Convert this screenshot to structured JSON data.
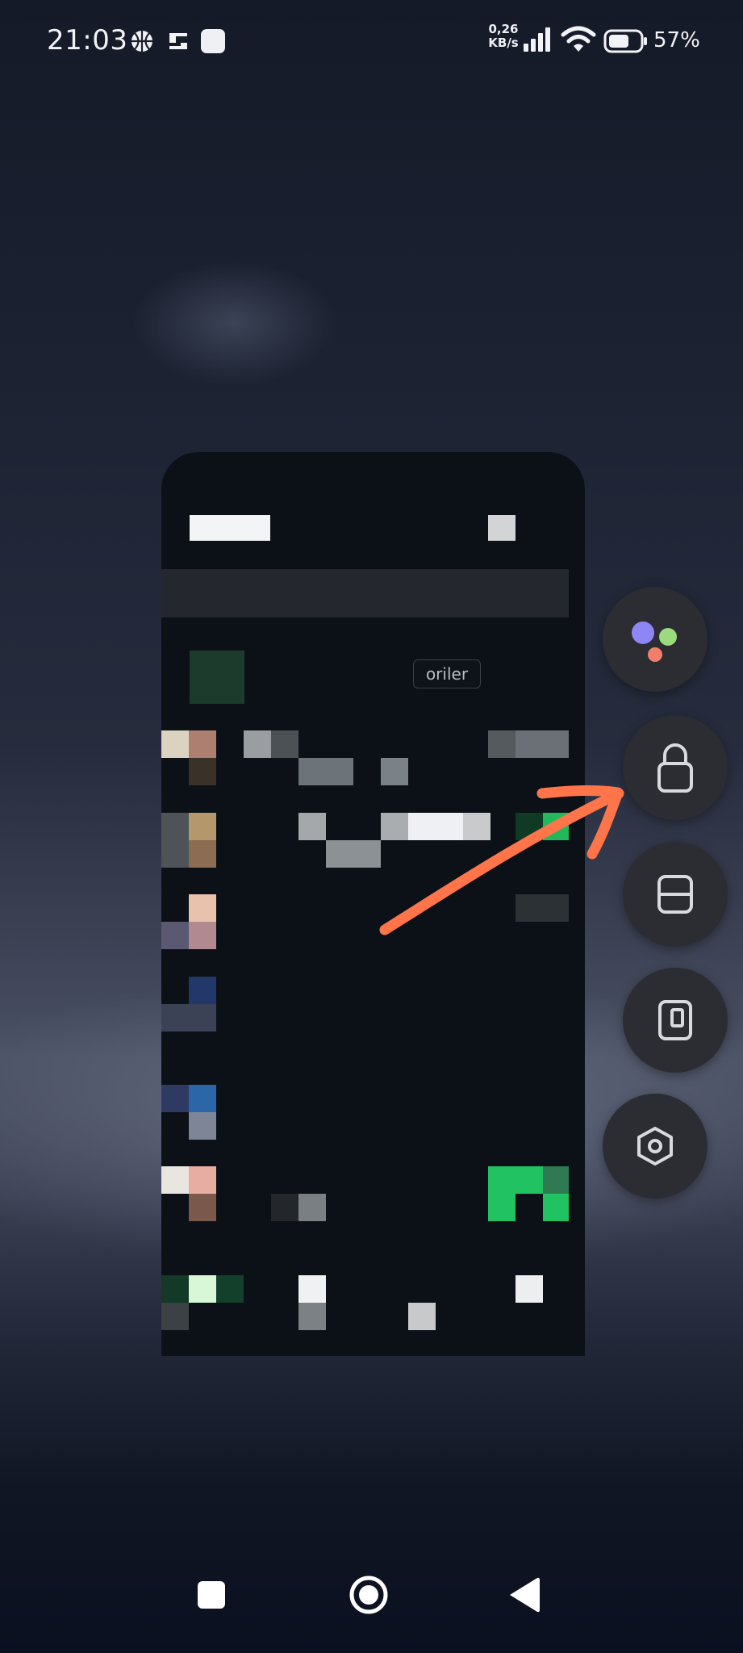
{
  "status_bar": {
    "time": "21:03",
    "notification_icons": [
      "basketball-icon",
      "app-notification-icon",
      "app-square-icon"
    ],
    "network_speed_value": "0,26",
    "network_speed_unit": "KB/s",
    "signal_icon": "cellular-signal-icon",
    "wifi_icon": "wifi-icon",
    "battery_icon": "battery-icon",
    "battery_percent": "57%"
  },
  "recent_app_card": {
    "visible_text": "oriler",
    "content_state": "pixelated"
  },
  "side_actions": [
    {
      "name": "assistant-button",
      "icon": "assistant-dots-icon"
    },
    {
      "name": "lock-app-button",
      "icon": "lock-icon"
    },
    {
      "name": "split-screen-button",
      "icon": "split-screen-icon"
    },
    {
      "name": "floating-window-button",
      "icon": "floating-window-icon"
    },
    {
      "name": "app-settings-button",
      "icon": "hexagon-settings-icon"
    }
  ],
  "annotation": {
    "type": "hand-drawn-arrow",
    "color": "#ff7448",
    "points_to": "lock-app-button"
  },
  "nav_bar": {
    "buttons": [
      "recents-button",
      "home-button",
      "back-button"
    ]
  },
  "colors": {
    "accent_arrow": "#ff7448",
    "side_button_bg": "#2b2d33",
    "status_text": "#f2f3f6"
  }
}
